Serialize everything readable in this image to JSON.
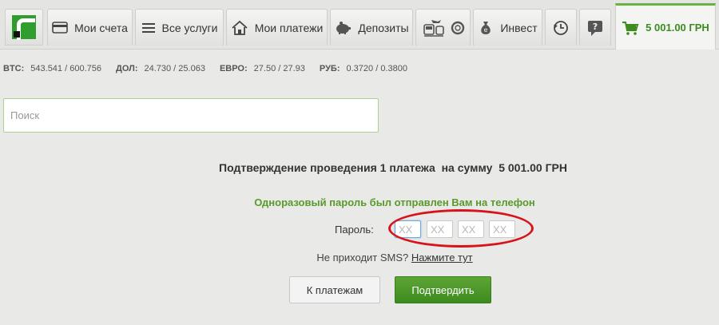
{
  "nav": {
    "accounts_label": "Мои счета",
    "services_label": "Все услуги",
    "payments_label": "Мои платежи",
    "deposits_label": "Депозиты",
    "invest_label": "Инвест",
    "cart_amount": "5 001.00 ГРН"
  },
  "rates": [
    {
      "name": "BTC:",
      "value": "543.541 / 600.756"
    },
    {
      "name": "ДОЛ:",
      "value": "24.730 / 25.063"
    },
    {
      "name": "ЕВРО:",
      "value": "27.50 / 27.93"
    },
    {
      "name": "РУБ:",
      "value": "0.3720 / 0.3800"
    }
  ],
  "search": {
    "placeholder": "Поиск"
  },
  "confirm": {
    "title": "Подтверждение проведения 1 платежа  на сумму  5 001.00 ГРН",
    "sent_message": "Одноразовый пароль был отправлен Вам на телефон",
    "password_label": "Пароль:",
    "otp_placeholder": "XX",
    "sms_question": "Не приходит SMS?",
    "sms_link": "Нажмите тут",
    "back_button": "К платежам",
    "confirm_button": "Подтвердить"
  },
  "colors": {
    "accent_green": "#5a9a2a",
    "button_green": "#4c9a2a",
    "annotation_red": "#d7131b"
  }
}
